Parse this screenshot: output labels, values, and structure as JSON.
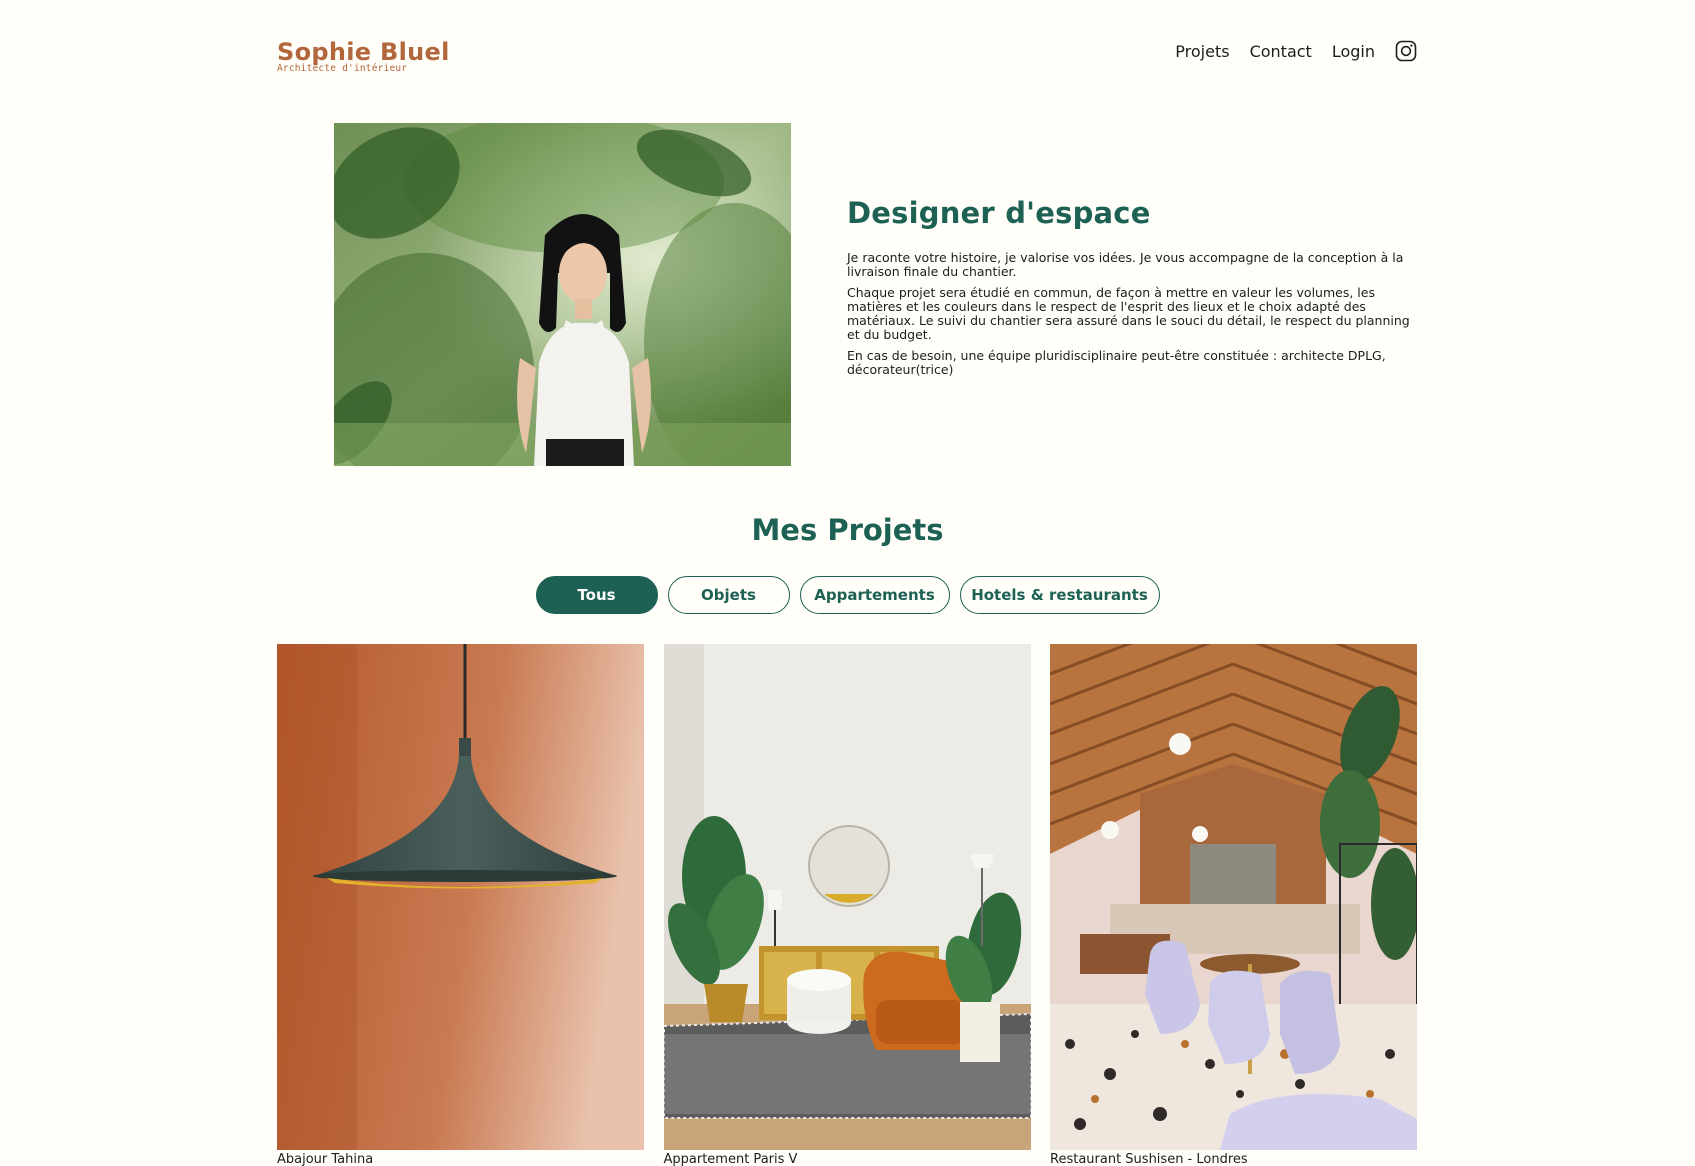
{
  "header": {
    "logo_title": "Sophie Bluel",
    "logo_subtitle": "Architecte d'intérieur",
    "nav": [
      "Projets",
      "Contact",
      "Login"
    ],
    "instagram_icon": "instagram-icon"
  },
  "intro": {
    "title": "Designer d'espace",
    "paragraphs": [
      "Je raconte votre histoire, je valorise vos idées. Je vous accompagne de la conception à la livraison finale du chantier.",
      "Chaque projet sera étudié en commun, de façon à mettre en valeur les volumes, les matières et les couleurs dans le respect de l'esprit des lieux et le choix adapté des matériaux. Le suivi du chantier sera assuré dans le souci du détail, le respect du planning et du budget.",
      "En cas de besoin, une équipe pluridisciplinaire peut-être constituée : architecte DPLG, décorateur(trice)"
    ]
  },
  "projects": {
    "title": "Mes Projets",
    "filters": [
      "Tous",
      "Objets",
      "Appartements",
      "Hotels & restaurants"
    ],
    "active_filter": "Tous",
    "items": [
      {
        "caption": "Abajour Tahina"
      },
      {
        "caption": "Appartement Paris V"
      },
      {
        "caption": "Restaurant Sushisen - Londres"
      }
    ]
  },
  "colors": {
    "background": "#FFFEF8",
    "brand_green": "#1D6154",
    "logo_brown": "#B1663C"
  }
}
